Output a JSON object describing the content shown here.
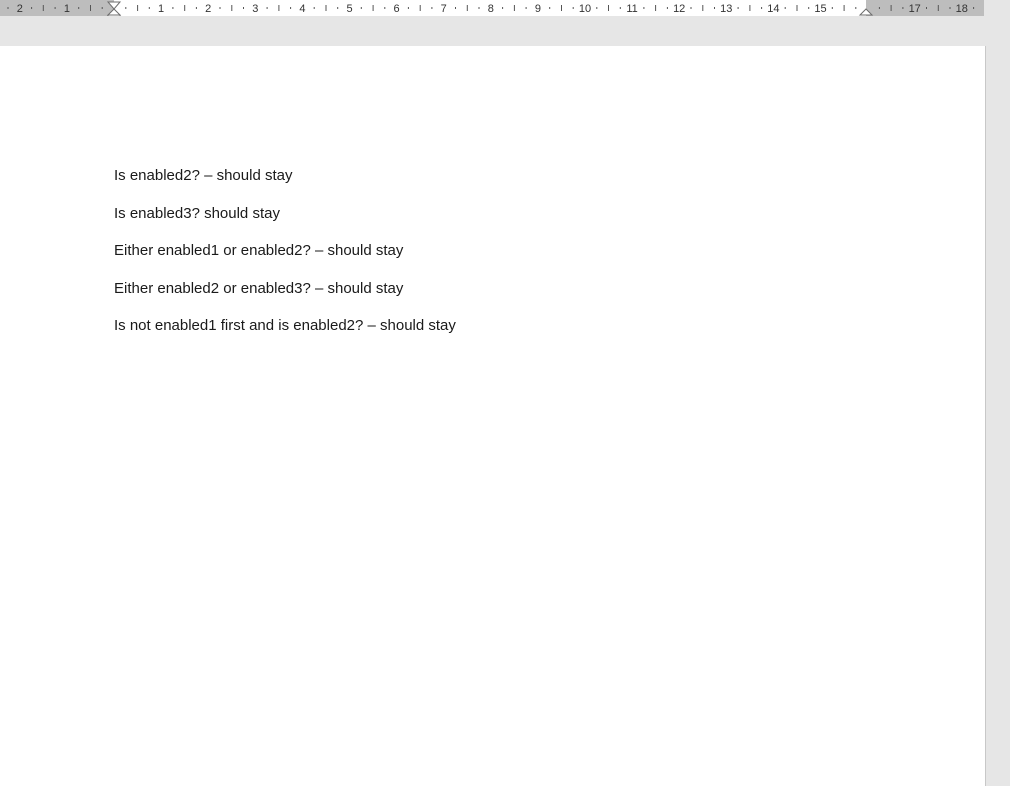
{
  "ruler": {
    "left_numbers": [
      "2",
      "1"
    ],
    "right_numbers": [
      "1",
      "2",
      "3",
      "4",
      "5",
      "6",
      "7",
      "8",
      "9",
      "10",
      "11",
      "12",
      "13",
      "14",
      "15",
      "17",
      "18"
    ]
  },
  "document": {
    "lines": [
      "Is enabled2? – should stay",
      "Is enabled3? should stay",
      "Either enabled1 or enabled2? – should stay",
      "Either enabled2 or enabled3? – should stay",
      "Is not enabled1 first and is enabled2? – should stay"
    ]
  },
  "colors": {
    "ruler_margin": "#bdbdbd",
    "ruler_active": "#ffffff",
    "page": "#ffffff",
    "workspace": "#e6e6e6"
  }
}
